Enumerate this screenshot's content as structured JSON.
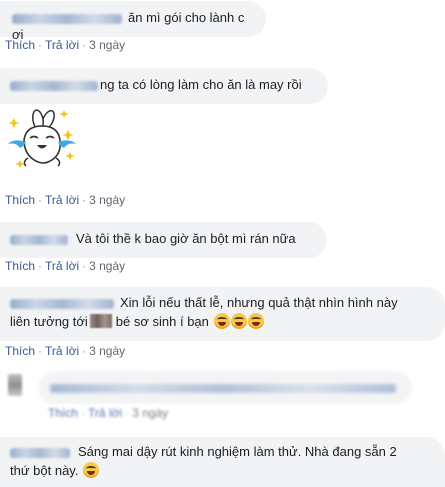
{
  "actions": {
    "like": "Thích",
    "dot": "·",
    "reply": "Trả lời"
  },
  "comments": [
    {
      "text": "ăn mì gói cho lành c ơi",
      "time": "3 ngày"
    },
    {
      "text": "ng ta có lòng làm cho ăn là may rồi",
      "time": "3 ngày"
    },
    {
      "sticker": "rabbit-laughing-crying-sticker",
      "time": "3 ngày"
    },
    {
      "text": "Và tôi thề k bao giờ ăn bột mì rán nữa",
      "time": "3 ngày"
    },
    {
      "text_line1": "Xin lỗi nếu thất lễ, nhưng quả thật nhìn hình này",
      "text_line2_a": "liên tưởng tới",
      "text_line2_b": "bé sơ sinh í bạn",
      "emojis": [
        "laughing-emoji",
        "laughing-emoji",
        "laughing-emoji"
      ],
      "time": "3 ngày"
    },
    {
      "reply_time": "3 ngày"
    },
    {
      "text_line1": "Sáng mai dậy rút kinh nghiệm làm thử. Nhà đang sẵn 2",
      "text_line2": "thứ bột này.",
      "emojis": [
        "laughing-emoji"
      ]
    }
  ],
  "colors": {
    "bubble": "#f2f3f5",
    "link": "#385898",
    "meta": "#606770"
  }
}
